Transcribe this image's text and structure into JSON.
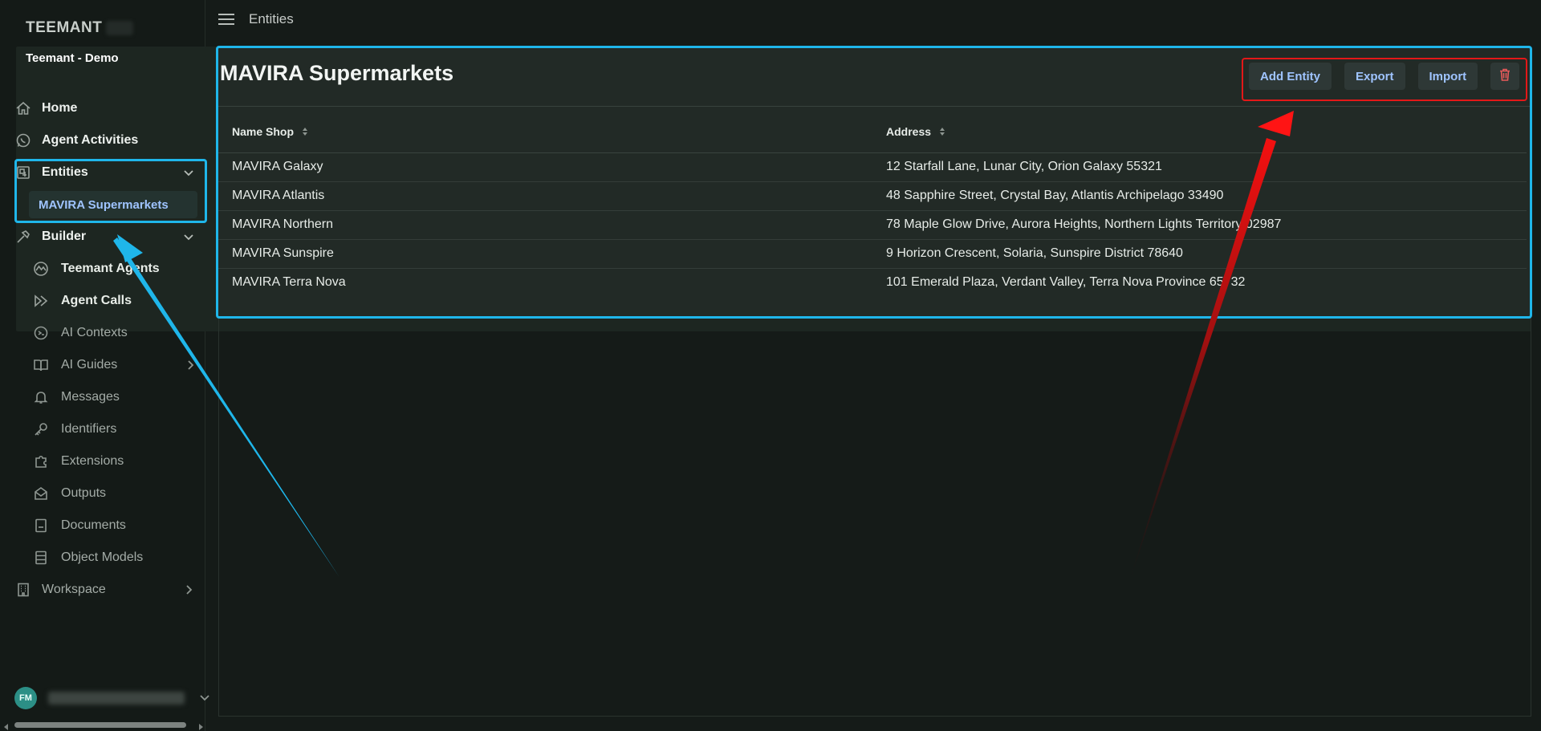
{
  "app": {
    "brand": "TEEMANT",
    "workspace": "Teemant - Demo"
  },
  "header": {
    "title": "Entities"
  },
  "sidebar": {
    "items": [
      {
        "label": "Home",
        "icon": "home-icon"
      },
      {
        "label": "Agent Activities",
        "icon": "whatsapp-icon"
      },
      {
        "label": "Entities",
        "icon": "entities-icon",
        "expanded": true
      },
      {
        "label": "Builder",
        "icon": "hammer-icon",
        "expanded": true
      },
      {
        "label": "Workspace",
        "icon": "building-icon"
      }
    ],
    "entities_children": [
      "MAVIRA Supermarkets"
    ],
    "builder_children": [
      {
        "label": "Teemant Agents",
        "icon": "agent-icon"
      },
      {
        "label": "Agent Calls",
        "icon": "play-forward-icon"
      },
      {
        "label": "AI Contexts",
        "icon": "context-icon"
      },
      {
        "label": "AI Guides",
        "icon": "book-icon"
      },
      {
        "label": "Messages",
        "icon": "bell-icon"
      },
      {
        "label": "Identifiers",
        "icon": "key-icon"
      },
      {
        "label": "Extensions",
        "icon": "puzzle-icon"
      },
      {
        "label": "Outputs",
        "icon": "envelope-icon"
      },
      {
        "label": "Documents",
        "icon": "document-icon"
      },
      {
        "label": "Object Models",
        "icon": "object-model-icon"
      }
    ],
    "user": {
      "initials": "FM"
    }
  },
  "main": {
    "title": "MAVIRA Supermarkets",
    "actions": {
      "add": "Add Entity",
      "export": "Export",
      "import": "Import",
      "delete_icon": "trash-icon"
    },
    "table": {
      "columns": [
        "Name Shop",
        "Address"
      ],
      "rows": [
        [
          "MAVIRA Galaxy",
          "12 Starfall Lane, Lunar City, Orion Galaxy 55321"
        ],
        [
          "MAVIRA Atlantis",
          "48 Sapphire Street, Crystal Bay, Atlantis Archipelago 33490"
        ],
        [
          "MAVIRA Northern",
          "78 Maple Glow Drive, Aurora Heights, Northern Lights Territory 02987"
        ],
        [
          "MAVIRA Sunspire",
          "9 Horizon Crescent, Solaria, Sunspire District 78640"
        ],
        [
          "MAVIRA Terra Nova",
          "101 Emerald Plaza, Verdant Valley, Terra Nova Province 65732"
        ]
      ]
    }
  },
  "colors": {
    "accent": "#9fc4ff",
    "annotation_blue": "#1fb6ea",
    "annotation_red": "#e31818",
    "avatar": "#2c8f86"
  }
}
